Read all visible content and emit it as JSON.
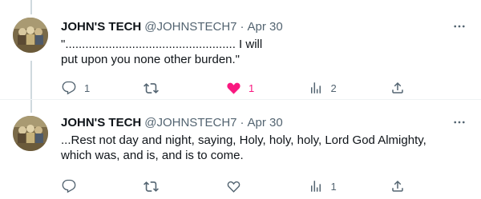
{
  "tweets": [
    {
      "author_name": "JOHN'S TECH",
      "handle": "@JOHNSTECH7",
      "separator": "·",
      "date": "Apr 30",
      "text": "\"................................................... I will\nput upon you none other burden.\"",
      "replies": "1",
      "retweets": "",
      "likes": "1",
      "liked": true,
      "views": "2"
    },
    {
      "author_name": "JOHN'S TECH",
      "handle": "@JOHNSTECH7",
      "separator": "·",
      "date": "Apr 30",
      "text": "...Rest not day and night, saying, Holy, holy, holy, Lord God Almighty,\nwhich was, and is, and is to come.",
      "replies": "",
      "retweets": "",
      "likes": "",
      "liked": false,
      "views": "1"
    }
  ],
  "icons": {
    "reply": "reply-icon",
    "retweet": "retweet-icon",
    "like": "heart-icon",
    "views": "analytics-icon",
    "share": "share-icon",
    "more": "more-icon"
  },
  "colors": {
    "text": "#0f1419",
    "secondary": "#536471",
    "like": "#f91880",
    "thread_line": "#cfd9de",
    "divider": "#eff3f4"
  }
}
